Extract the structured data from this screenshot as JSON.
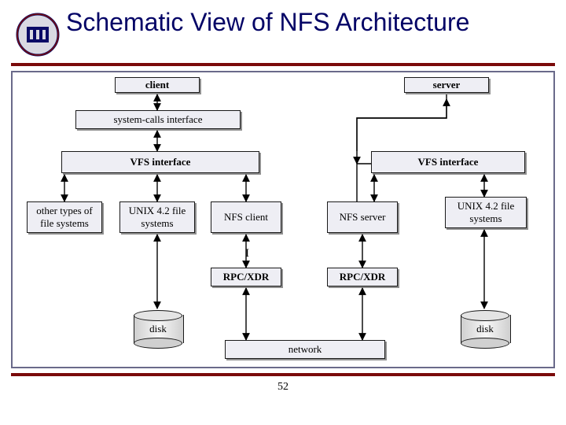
{
  "slide": {
    "title": "Schematic View of NFS Architecture",
    "page_number": "52"
  },
  "headers": {
    "client": "client",
    "server": "server"
  },
  "boxes": {
    "syscalls": "system-calls interface",
    "vfs_client": "VFS interface",
    "vfs_server": "VFS interface",
    "other_fs": "other types of file systems",
    "unix_client": "UNIX 4.2 file systems",
    "nfs_client": "NFS client",
    "nfs_server": "NFS server",
    "unix_server": "UNIX 4.2 file systems",
    "rpc_client": "RPC/XDR",
    "rpc_server": "RPC/XDR",
    "network": "network",
    "disk_client": "disk",
    "disk_server": "disk"
  },
  "cursor_hint": "I"
}
